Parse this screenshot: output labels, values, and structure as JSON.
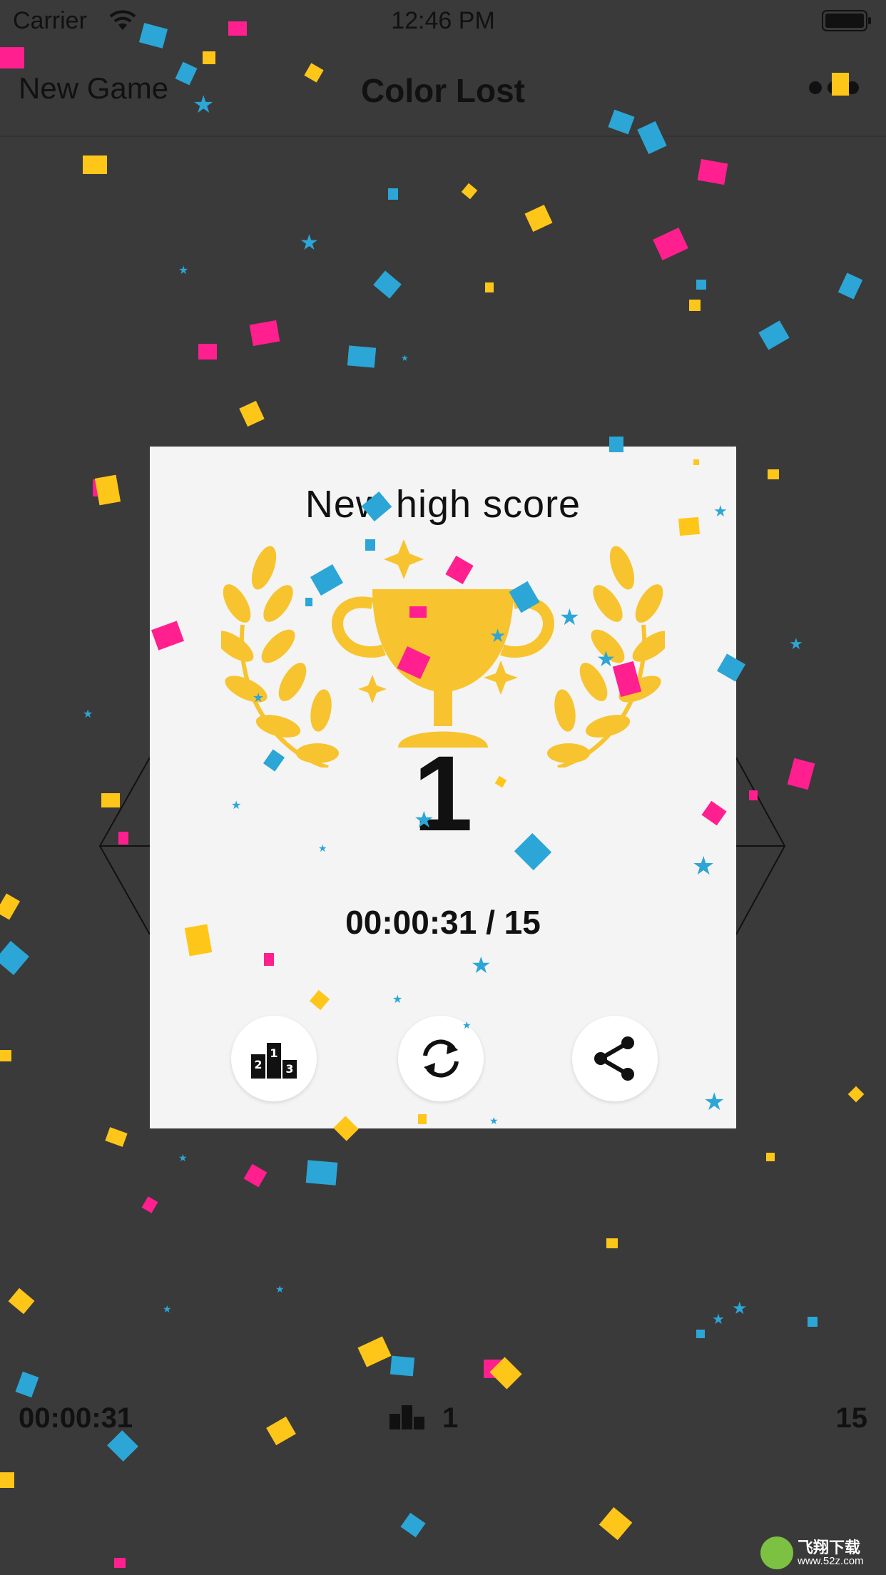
{
  "status_bar": {
    "carrier": "Carrier",
    "time": "12:46 PM"
  },
  "nav": {
    "left_button": "New Game",
    "title": "Color Lost"
  },
  "dialog": {
    "heading": "New high score",
    "score": "1",
    "time_and_level": "00:00:31 / 15",
    "buttons": [
      {
        "name": "leaderboard-button",
        "icon": "podium-icon"
      },
      {
        "name": "replay-button",
        "icon": "refresh-icon"
      },
      {
        "name": "share-button",
        "icon": "share-icon"
      }
    ]
  },
  "footer": {
    "elapsed": "00:00:31",
    "rank": "1",
    "level": "15"
  },
  "colors": {
    "background": "#3a3a3a",
    "dialog": "#f4f4f4",
    "trophy_gold": "#f7c42f",
    "confetti_pink": "#ff1f8e",
    "confetti_blue": "#2ba6d6",
    "confetti_yellow": "#ffc61a"
  },
  "watermark": {
    "line1": "飞翔下载",
    "line2": "www.52z.com"
  }
}
